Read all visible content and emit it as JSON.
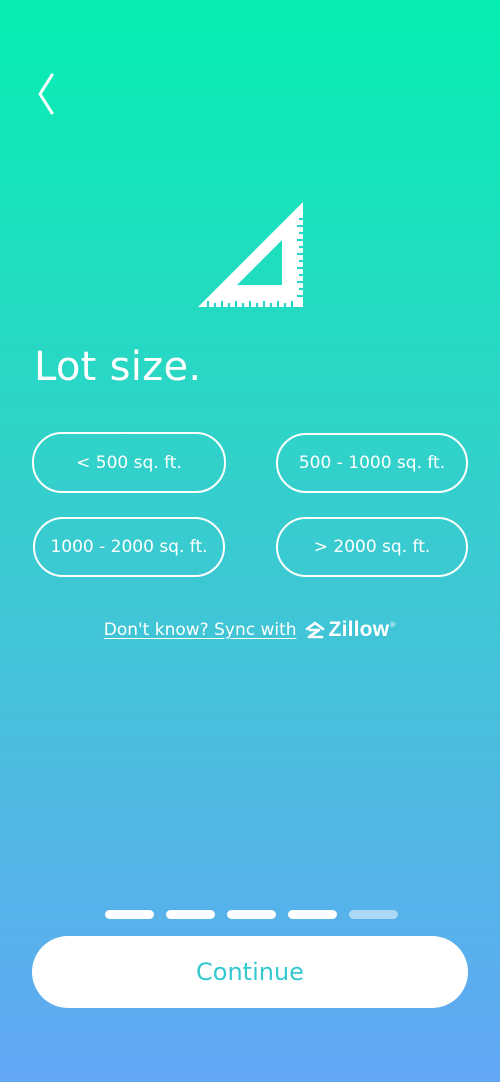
{
  "header": {
    "back_icon": "chevron-left-icon"
  },
  "hero": {
    "icon": "set-square-ruler-icon"
  },
  "title": "Lot size.",
  "options": [
    {
      "label": "< 500 sq. ft."
    },
    {
      "label": "500 - 1000 sq. ft."
    },
    {
      "label": "1000 - 2000 sq. ft."
    },
    {
      "label": "> 2000 sq. ft."
    }
  ],
  "sync": {
    "text": "Don't know? Sync with",
    "brand": "Zillow",
    "trademark": "®"
  },
  "progress": {
    "total_steps": 5,
    "current_step": 4
  },
  "continue_label": "Continue",
  "colors": {
    "gradient_top": "#05efb1",
    "gradient_bottom": "#62a7f5",
    "accent_text": "#34c8cf",
    "white": "#ffffff"
  }
}
